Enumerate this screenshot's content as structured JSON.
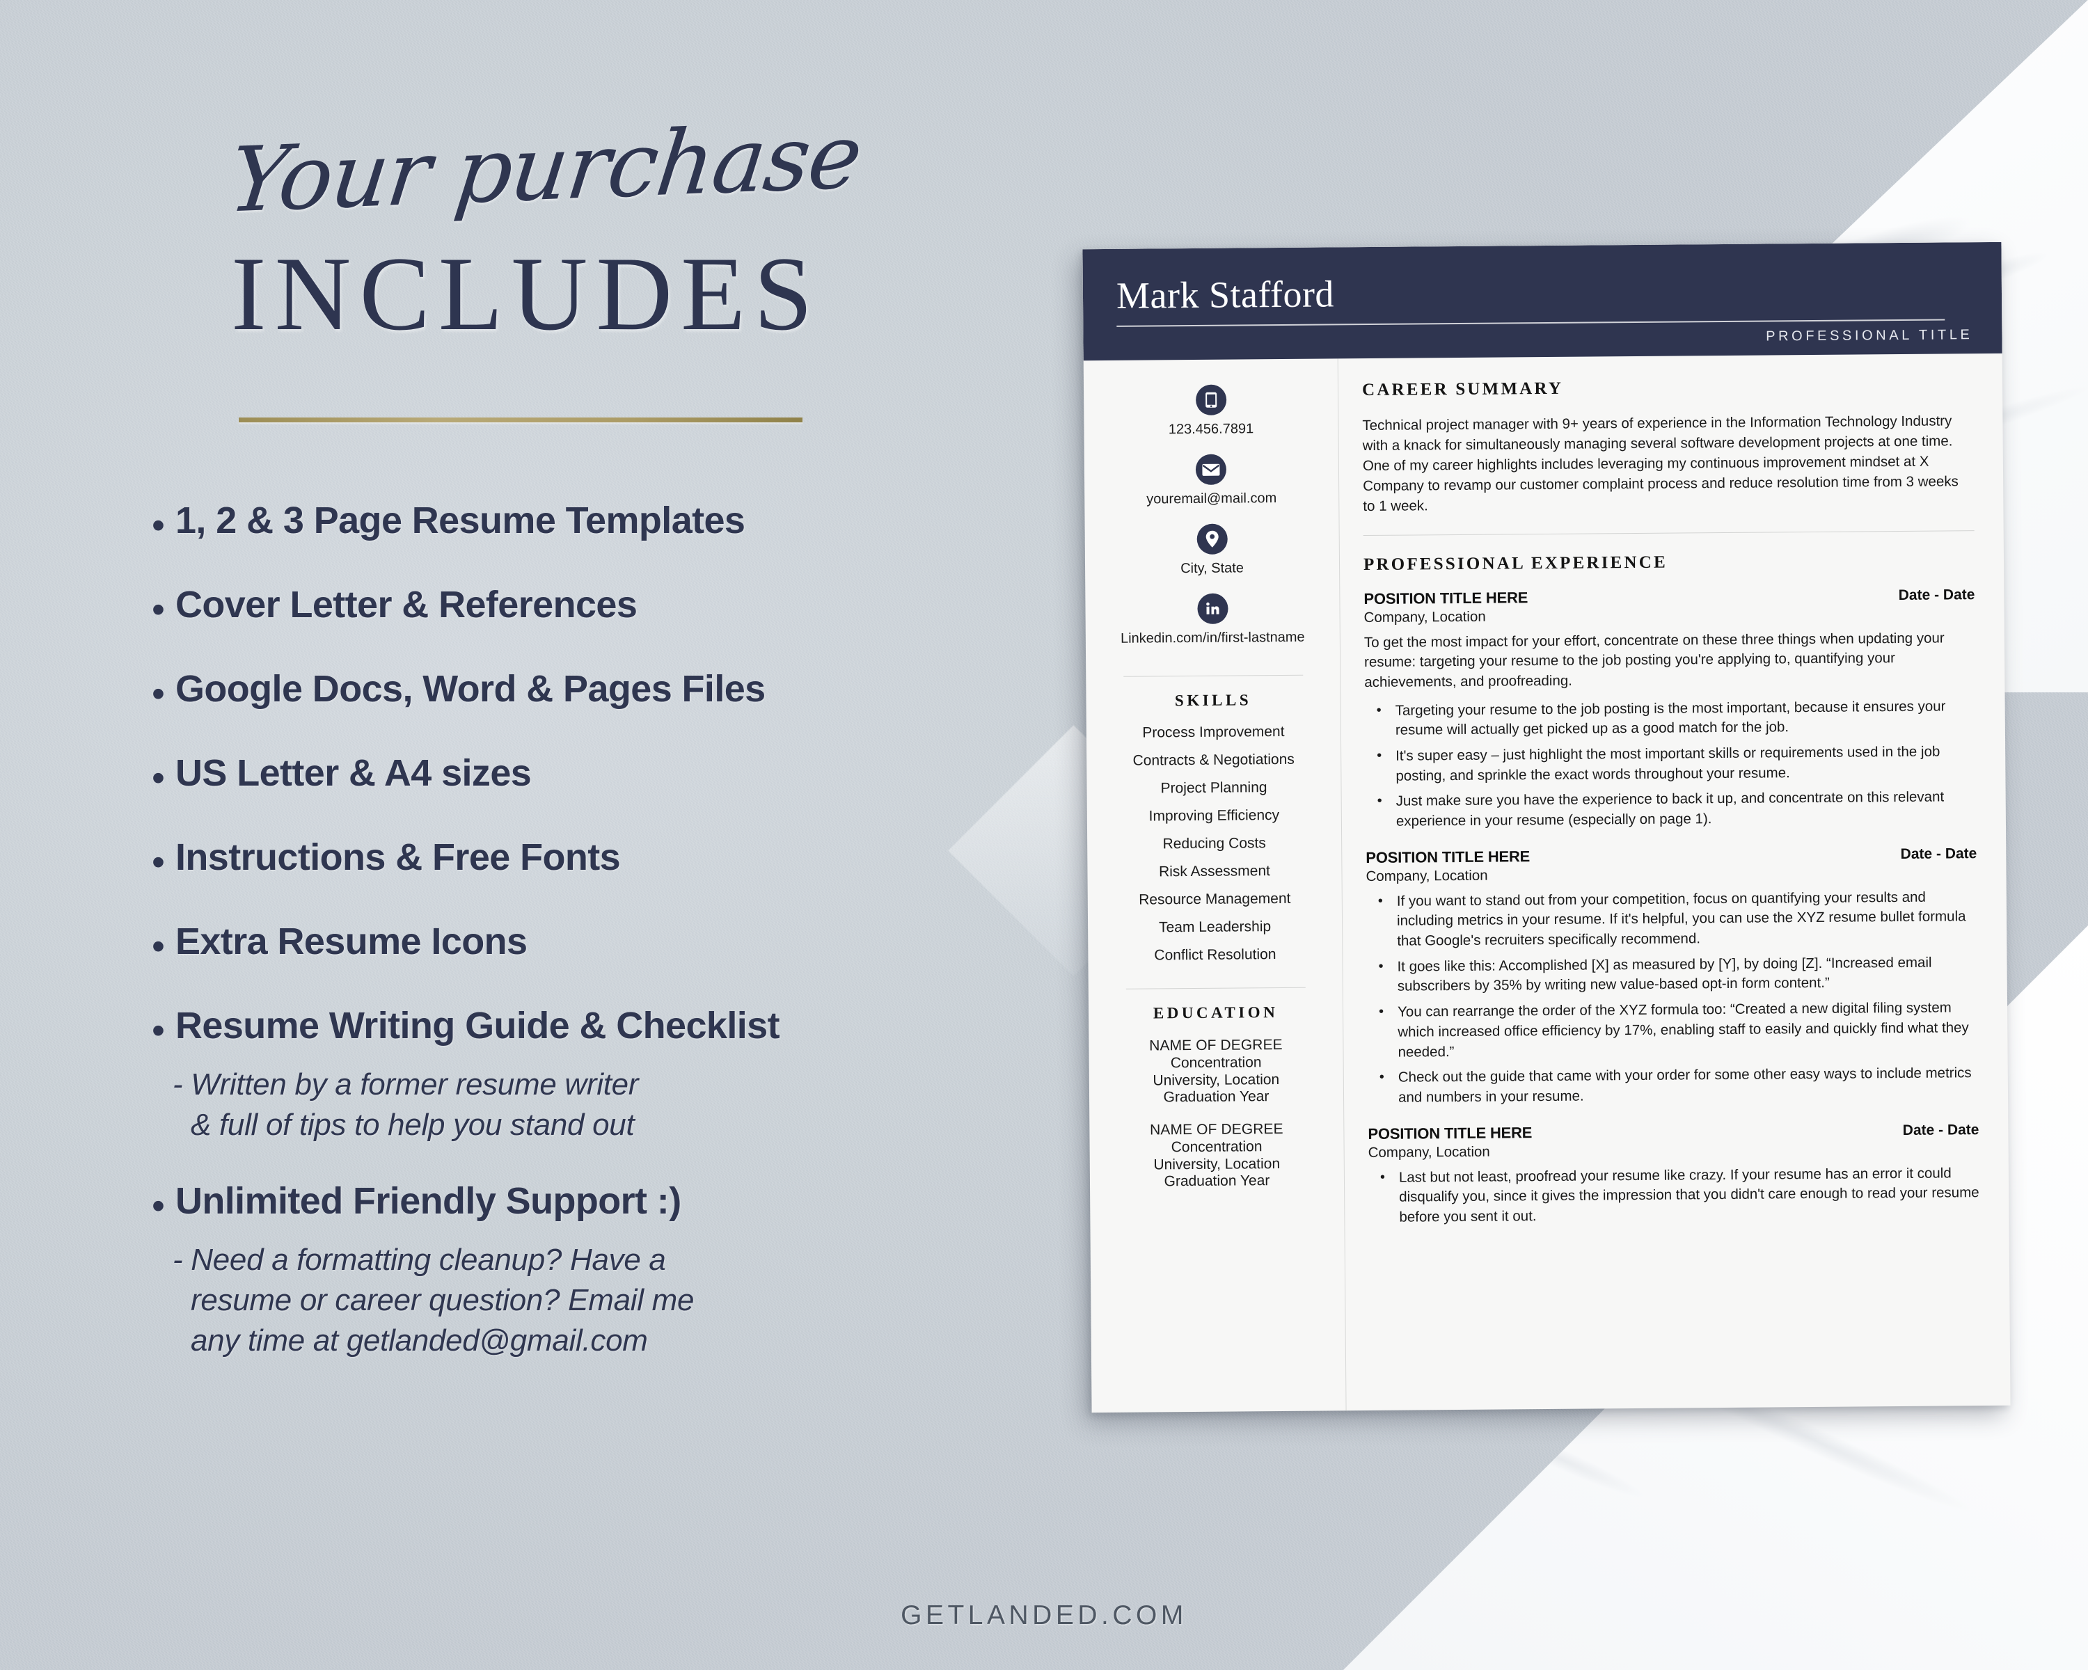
{
  "promo": {
    "script_title": "Your purchase",
    "main_title": "INCLUDES",
    "features": [
      "1, 2 & 3 Page Resume Templates",
      "Cover Letter & References",
      "Google Docs, Word & Pages Files",
      "US Letter & A4 sizes",
      "Instructions & Free Fonts",
      "Extra Resume Icons",
      "Resume Writing Guide & Checklist"
    ],
    "guide_note_line1": "- Written by a former resume writer",
    "guide_note_line2": "& full of tips to help you stand out",
    "support_feature": "Unlimited Friendly Support :)",
    "support_note_line1": "- Need a formatting cleanup? Have a",
    "support_note_line2": "resume or career question? Email me",
    "support_note_line3": "any time at getlanded@gmail.com",
    "footer_brand": "GETLANDED.COM",
    "accent_gold": "#a8975f",
    "navy": "#2f3550",
    "background": "#ccd2d8"
  },
  "resume": {
    "name": "Mark Stafford",
    "title": "PROFESSIONAL TITLE",
    "contacts": [
      {
        "icon": "phone-icon",
        "text": "123.456.7891"
      },
      {
        "icon": "envelope-icon",
        "text": "youremail@mail.com"
      },
      {
        "icon": "location-pin-icon",
        "text": "City, State"
      },
      {
        "icon": "linkedin-icon",
        "text": "Linkedin.com/in/first-lastname"
      }
    ],
    "skills_heading": "SKILLS",
    "skills": [
      "Process Improvement",
      "Contracts & Negotiations",
      "Project Planning",
      "Improving Efficiency",
      "Reducing Costs",
      "Risk Assessment",
      "Resource Management",
      "Team Leadership",
      "Conflict Resolution"
    ],
    "education_heading": "EDUCATION",
    "education": [
      {
        "degree": "NAME OF DEGREE",
        "concentration": "Concentration",
        "university": "University, Location",
        "year": "Graduation Year"
      },
      {
        "degree": "NAME OF DEGREE",
        "concentration": "Concentration",
        "university": "University, Location",
        "year": "Graduation Year"
      }
    ],
    "summary_heading": "CAREER SUMMARY",
    "summary_text": "Technical project manager with 9+ years of experience in the Information Technology Industry with a knack for simultaneously managing several software development projects at one time. One of my career highlights includes leveraging my continuous improvement mindset at X Company to revamp our customer complaint process and reduce resolution time from 3 weeks to 1 week.",
    "experience_heading": "PROFESSIONAL EXPERIENCE",
    "jobs": [
      {
        "title": "POSITION TITLE HERE",
        "date": "Date - Date",
        "company": "Company, Location",
        "intro": "To get the most impact for your effort, concentrate on these three things when updating your resume: targeting your resume to the job posting you're applying to, quantifying your achievements, and proofreading.",
        "bullets": [
          "Targeting your resume to the job posting is the most important, because it ensures your resume will actually get picked up as a good match for the job.",
          "It's super easy – just highlight the most important skills or requirements used in the job posting, and sprinkle the exact words throughout your resume.",
          "Just make sure you have the experience to back it up, and concentrate on this relevant experience in your resume (especially on page 1)."
        ]
      },
      {
        "title": "POSITION TITLE HERE",
        "date": "Date - Date",
        "company": "Company, Location",
        "intro": "",
        "bullets": [
          "If you want to stand out from your competition, focus on quantifying your results and including metrics in your resume. If it's helpful, you can use the XYZ resume bullet formula that Google's recruiters specifically recommend.",
          "It goes like this: Accomplished [X] as measured by [Y], by doing [Z]. “Increased email subscribers by 35% by writing new value-based opt-in form content.”",
          "You can rearrange the order of the XYZ formula too: “Created a new digital filing system which increased office efficiency by 17%, enabling staff to easily and quickly find what they needed.”",
          "Check out the guide that came with your order for some other easy ways to include metrics and numbers in your resume."
        ]
      },
      {
        "title": "POSITION TITLE HERE",
        "date": "Date - Date",
        "company": "Company, Location",
        "intro": "",
        "bullets": [
          "Last but not least, proofread your resume like crazy. If your resume has an error it could disqualify you, since it gives the impression that you didn't care enough to read your resume before you sent it out."
        ]
      }
    ]
  }
}
